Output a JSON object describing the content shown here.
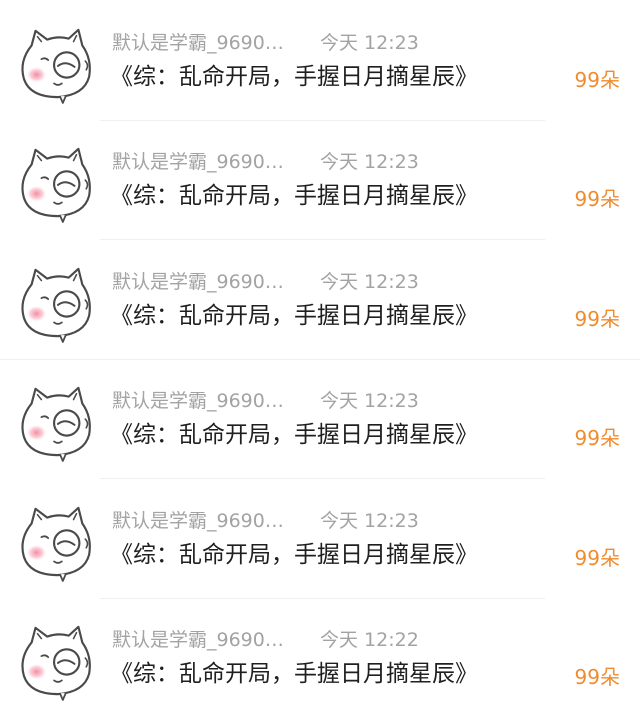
{
  "colors": {
    "accent": "#f08c2e",
    "muted": "#a3a3a3",
    "text": "#1f1f1f",
    "divider": "#f0f0f0"
  },
  "messages": [
    {
      "avatar_icon": "cartoon-cat-avatar",
      "username": "默认是学霸_9690…",
      "time": "今天 12:23",
      "title": "《综：乱命开局，手握日月摘星辰》",
      "amount": "99朵"
    },
    {
      "avatar_icon": "cartoon-cat-avatar",
      "username": "默认是学霸_9690…",
      "time": "今天 12:23",
      "title": "《综：乱命开局，手握日月摘星辰》",
      "amount": "99朵"
    },
    {
      "avatar_icon": "cartoon-cat-avatar",
      "username": "默认是学霸_9690…",
      "time": "今天 12:23",
      "title": "《综：乱命开局，手握日月摘星辰》",
      "amount": "99朵"
    },
    {
      "avatar_icon": "cartoon-cat-avatar",
      "username": "默认是学霸_9690…",
      "time": "今天 12:23",
      "title": "《综：乱命开局，手握日月摘星辰》",
      "amount": "99朵"
    },
    {
      "avatar_icon": "cartoon-cat-avatar",
      "username": "默认是学霸_9690…",
      "time": "今天 12:23",
      "title": "《综：乱命开局，手握日月摘星辰》",
      "amount": "99朵"
    },
    {
      "avatar_icon": "cartoon-cat-avatar",
      "username": "默认是学霸_9690…",
      "time": "今天 12:22",
      "title": "《综：乱命开局，手握日月摘星辰》",
      "amount": "99朵"
    }
  ]
}
